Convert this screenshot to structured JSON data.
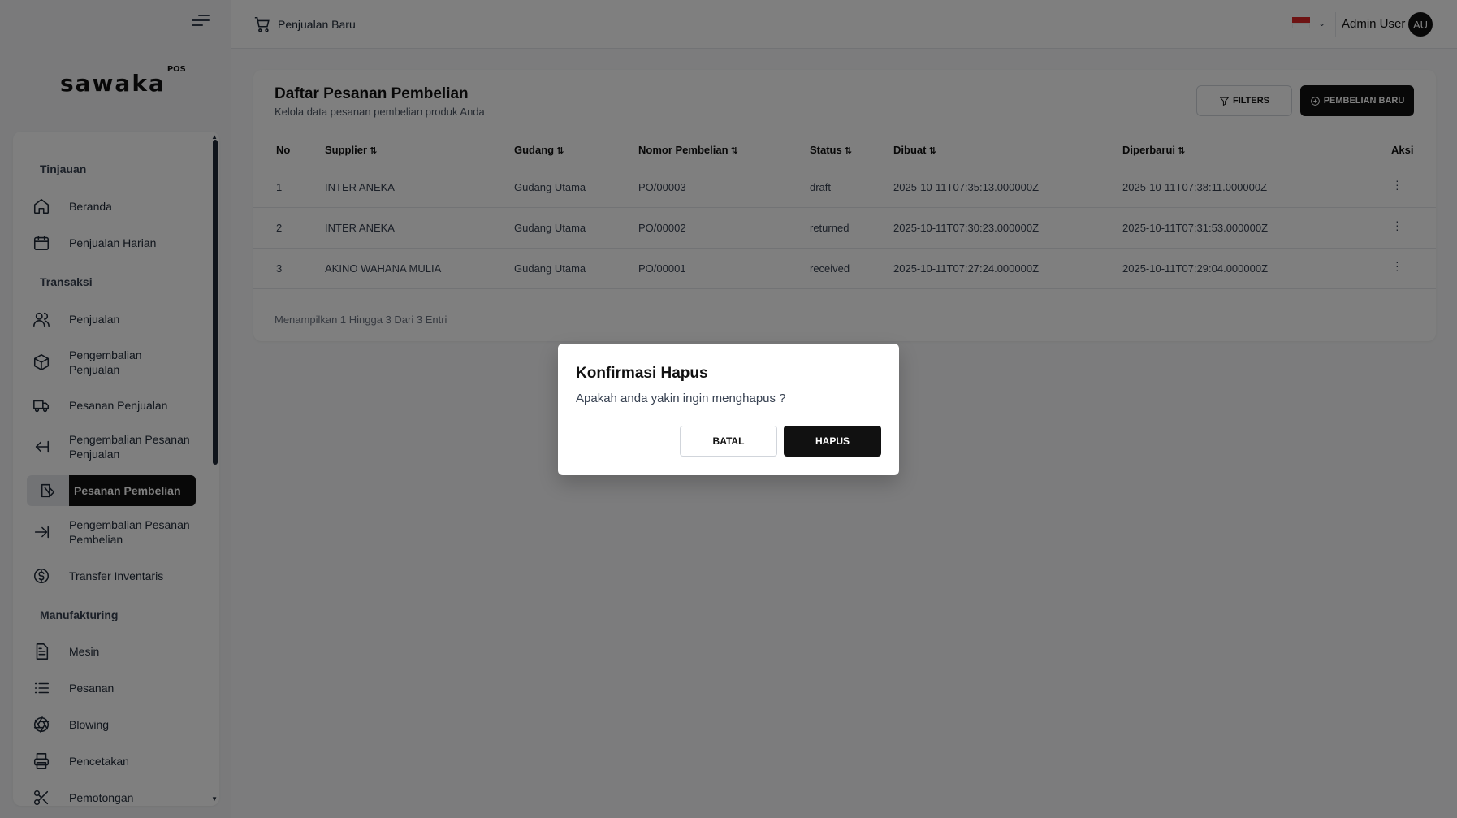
{
  "sidebar": {
    "logo": "sawaka",
    "logo_sup": "POS",
    "sections": [
      {
        "title": "Tinjauan"
      },
      {
        "title": "Transaksi"
      },
      {
        "title": "Manufakturing"
      }
    ],
    "items": [
      {
        "label": "Beranda",
        "icon": "home-icon"
      },
      {
        "label": "Penjualan Harian",
        "icon": "calendar-icon"
      },
      {
        "label": "Penjualan",
        "icon": "users-icon"
      },
      {
        "label": "Pengembalian Penjualan",
        "icon": "package-icon"
      },
      {
        "label": "Pesanan Penjualan",
        "icon": "truck-icon"
      },
      {
        "label": "Pengembalian Pesanan Penjualan",
        "icon": "arrow-left-icon"
      },
      {
        "label": "Pesanan Pembelian",
        "icon": "purchase-icon",
        "active": true
      },
      {
        "label": "Pengembalian Pesanan Pembelian",
        "icon": "arrow-right-icon"
      },
      {
        "label": "Transfer Inventaris",
        "icon": "dollar-icon"
      },
      {
        "label": "Mesin",
        "icon": "document-icon"
      },
      {
        "label": "Pesanan",
        "icon": "list-icon"
      },
      {
        "label": "Blowing",
        "icon": "aperture-icon"
      },
      {
        "label": "Pencetakan",
        "icon": "printer-icon"
      },
      {
        "label": "Pemotongan",
        "icon": "scissors-icon"
      }
    ]
  },
  "topbar": {
    "cart_label": "Penjualan Baru",
    "user_name": "Admin User",
    "avatar_initials": "AU"
  },
  "card": {
    "title": "Daftar Pesanan Pembelian",
    "subtitle": "Kelola data pesanan pembelian produk Anda",
    "filter_label": "FILTERS",
    "new_label": "PEMBELIAN BARU",
    "columns": [
      "No",
      "Supplier",
      "Gudang",
      "Nomor Pembelian",
      "Status",
      "Dibuat",
      "Diperbarui",
      "Aksi"
    ],
    "rows": [
      {
        "no": "1",
        "supplier": "INTER ANEKA",
        "gudang": "Gudang Utama",
        "nomor": "PO/00003",
        "status": "draft",
        "dibuat": "2025-10-11T07:35:13.000000Z",
        "diperbarui": "2025-10-11T07:38:11.000000Z"
      },
      {
        "no": "2",
        "supplier": "INTER ANEKA",
        "gudang": "Gudang Utama",
        "nomor": "PO/00002",
        "status": "returned",
        "dibuat": "2025-10-11T07:30:23.000000Z",
        "diperbarui": "2025-10-11T07:31:53.000000Z"
      },
      {
        "no": "3",
        "supplier": "AKINO WAHANA MULIA",
        "gudang": "Gudang Utama",
        "nomor": "PO/00001",
        "status": "received",
        "dibuat": "2025-10-11T07:27:24.000000Z",
        "diperbarui": "2025-10-11T07:29:04.000000Z"
      }
    ],
    "footer": "Menampilkan 1 Hingga 3 Dari 3 Entri"
  },
  "modal": {
    "title": "Konfirmasi Hapus",
    "message": "Apakah anda yakin ingin menghapus ?",
    "cancel_label": "BATAL",
    "delete_label": "HAPUS"
  }
}
